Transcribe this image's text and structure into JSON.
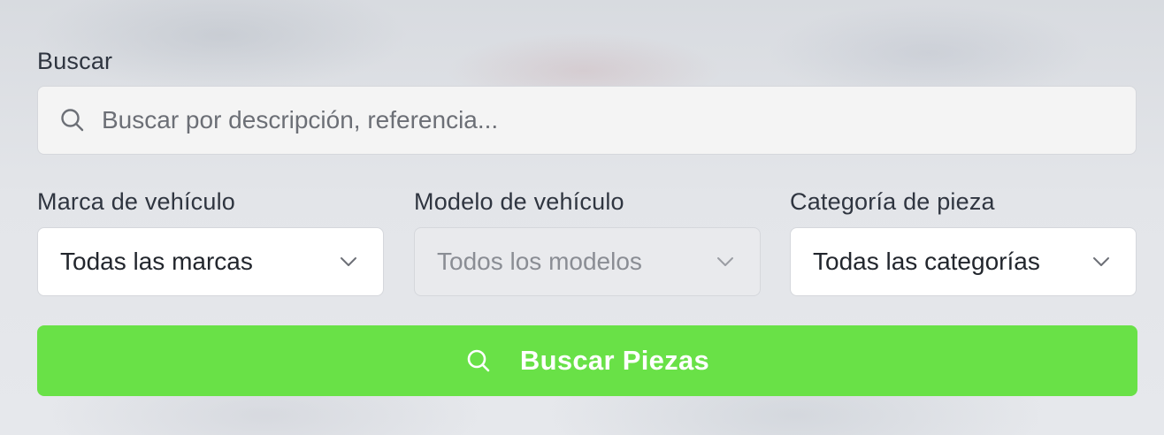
{
  "search": {
    "label": "Buscar",
    "placeholder": "Buscar por descripción, referencia..."
  },
  "filters": {
    "brand": {
      "label": "Marca de vehículo",
      "value": "Todas las marcas"
    },
    "model": {
      "label": "Modelo de vehículo",
      "value": "Todos los modelos",
      "disabled": true
    },
    "category": {
      "label": "Categoría de pieza",
      "value": "Todas las categorías"
    }
  },
  "submit": {
    "label": "Buscar Piezas"
  },
  "colors": {
    "accent": "#69e147",
    "input_bg": "#f4f4f4",
    "label_text": "#2f3540"
  },
  "icons": {
    "search_field": "search-icon",
    "dropdown": "chevron-down-icon",
    "submit": "search-icon"
  }
}
